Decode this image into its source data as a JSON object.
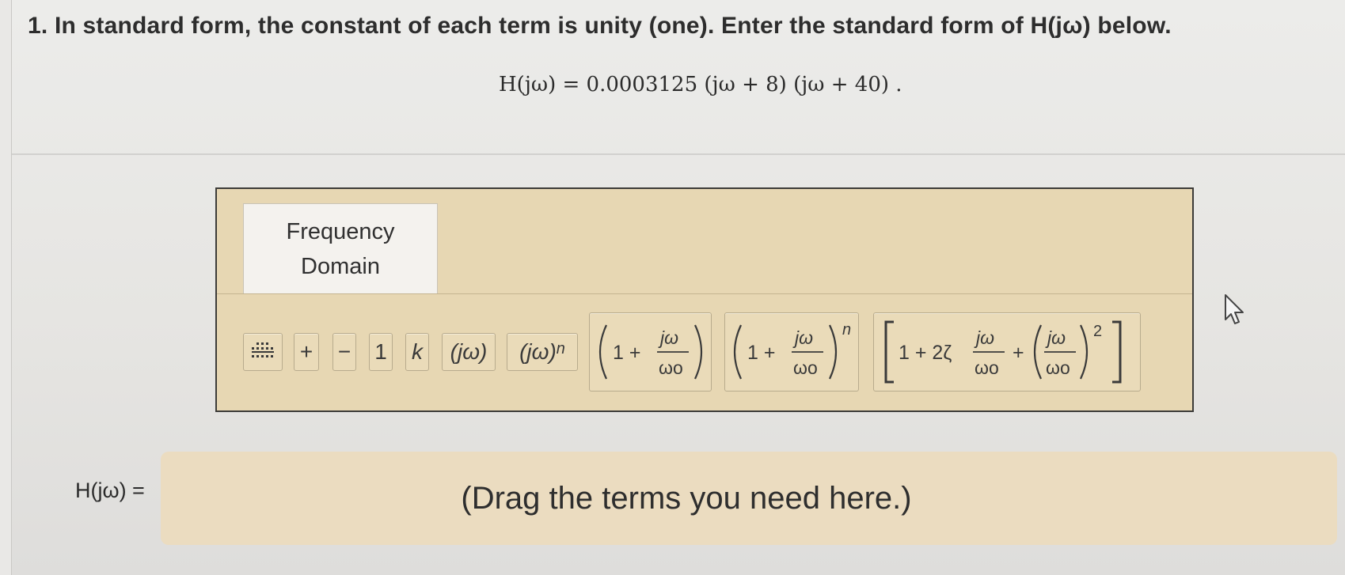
{
  "question": {
    "text": "1. In standard form, the constant of each term is unity (one). Enter the standard form of H(jω) below.",
    "equation": "H(jω) = 0.0003125 (jω + 8) (jω + 40) ."
  },
  "palette": {
    "tab_label_line1": "Frequency",
    "tab_label_line2": "Domain",
    "tiles": {
      "fraction_label": "fraction",
      "plus": "+",
      "minus": "−",
      "one": "1",
      "k": "k",
      "jw": "(jω)",
      "jw_pow_n": "(jω)",
      "n_exponent": "n",
      "first_order_prefix": "1 +",
      "second_order_prefix": "1 + 2ζ",
      "num_jw": "jω",
      "den_wo": "ωo",
      "two": "2"
    }
  },
  "answer": {
    "label": "H(jω) =",
    "placeholder": "(Drag the terms you need here.)"
  }
}
